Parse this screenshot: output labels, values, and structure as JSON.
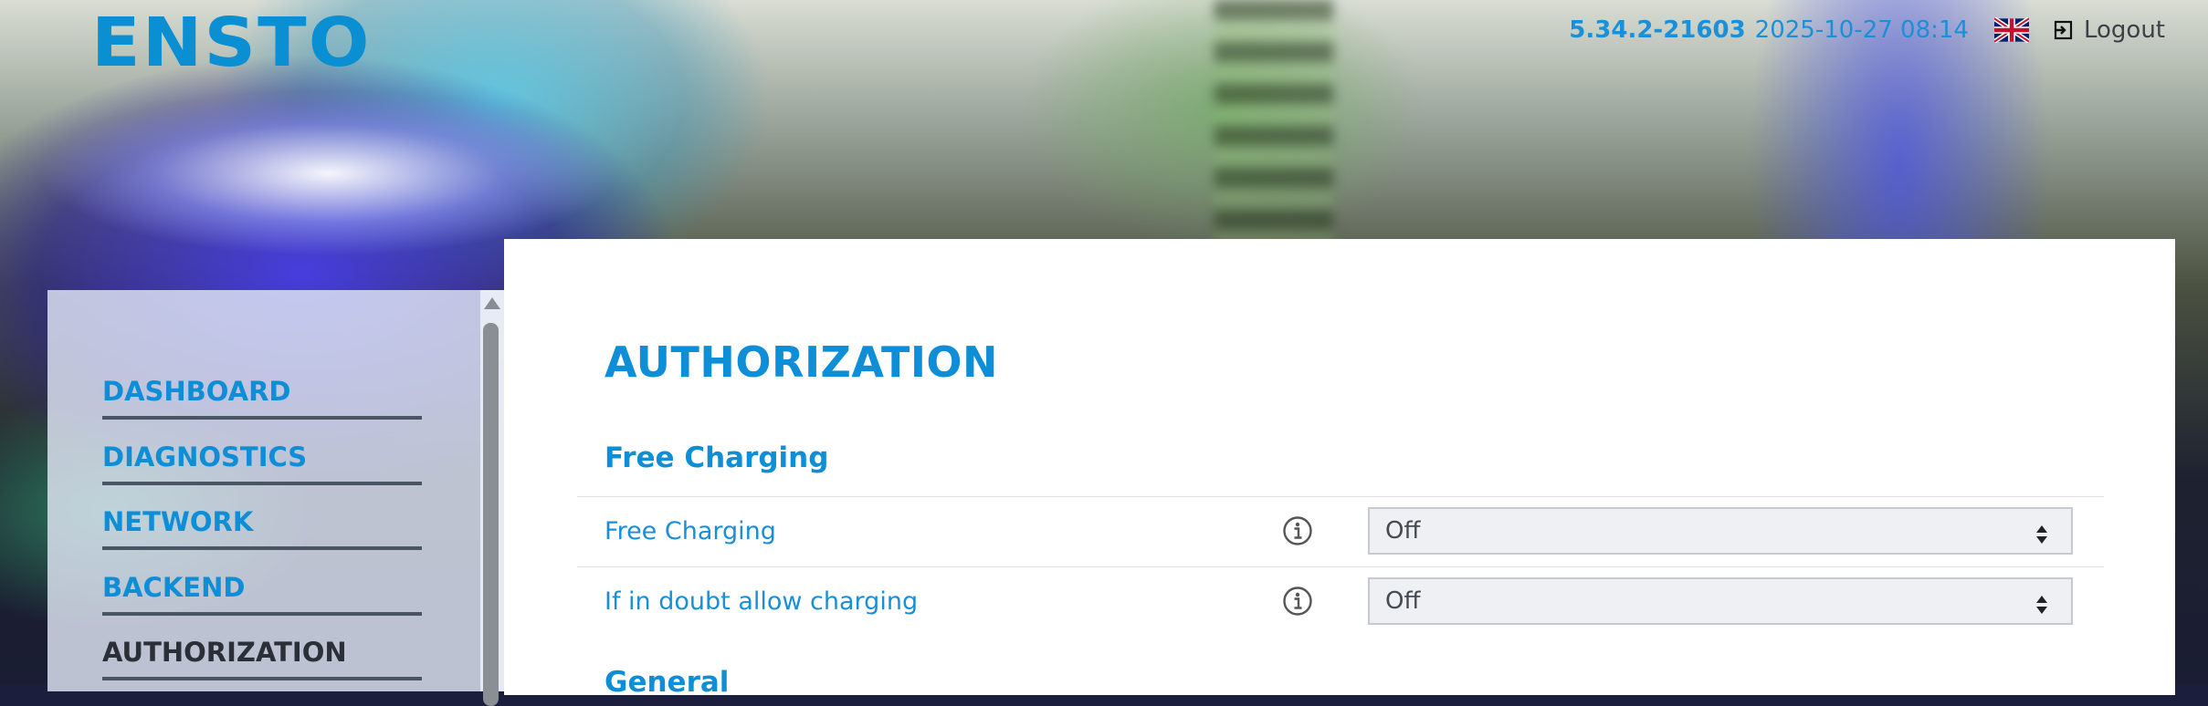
{
  "brand": {
    "logo_text": "ENSTO",
    "color": "#0b8fd3"
  },
  "header": {
    "version": "5.34.2-21603",
    "datetime": "2025-10-27 08:14",
    "language_icon": "uk-flag-icon",
    "logout_label": "Logout"
  },
  "sidebar": {
    "items": [
      {
        "label": "DASHBOARD",
        "active": false
      },
      {
        "label": "DIAGNOSTICS",
        "active": false
      },
      {
        "label": "NETWORK",
        "active": false
      },
      {
        "label": "BACKEND",
        "active": false
      },
      {
        "label": "AUTHORIZATION",
        "active": true
      }
    ]
  },
  "main": {
    "title": "AUTHORIZATION",
    "sections": [
      {
        "title": "Free Charging",
        "rows": [
          {
            "label": "Free Charging",
            "info_icon": "info-icon",
            "value": "Off"
          },
          {
            "label": "If in doubt allow charging",
            "info_icon": "info-icon",
            "value": "Off"
          }
        ]
      },
      {
        "title": "General",
        "rows": []
      }
    ]
  },
  "colors": {
    "accent": "#0d8ed6",
    "active_nav": "#2a2f38",
    "nav_divider": "#4a5563"
  }
}
